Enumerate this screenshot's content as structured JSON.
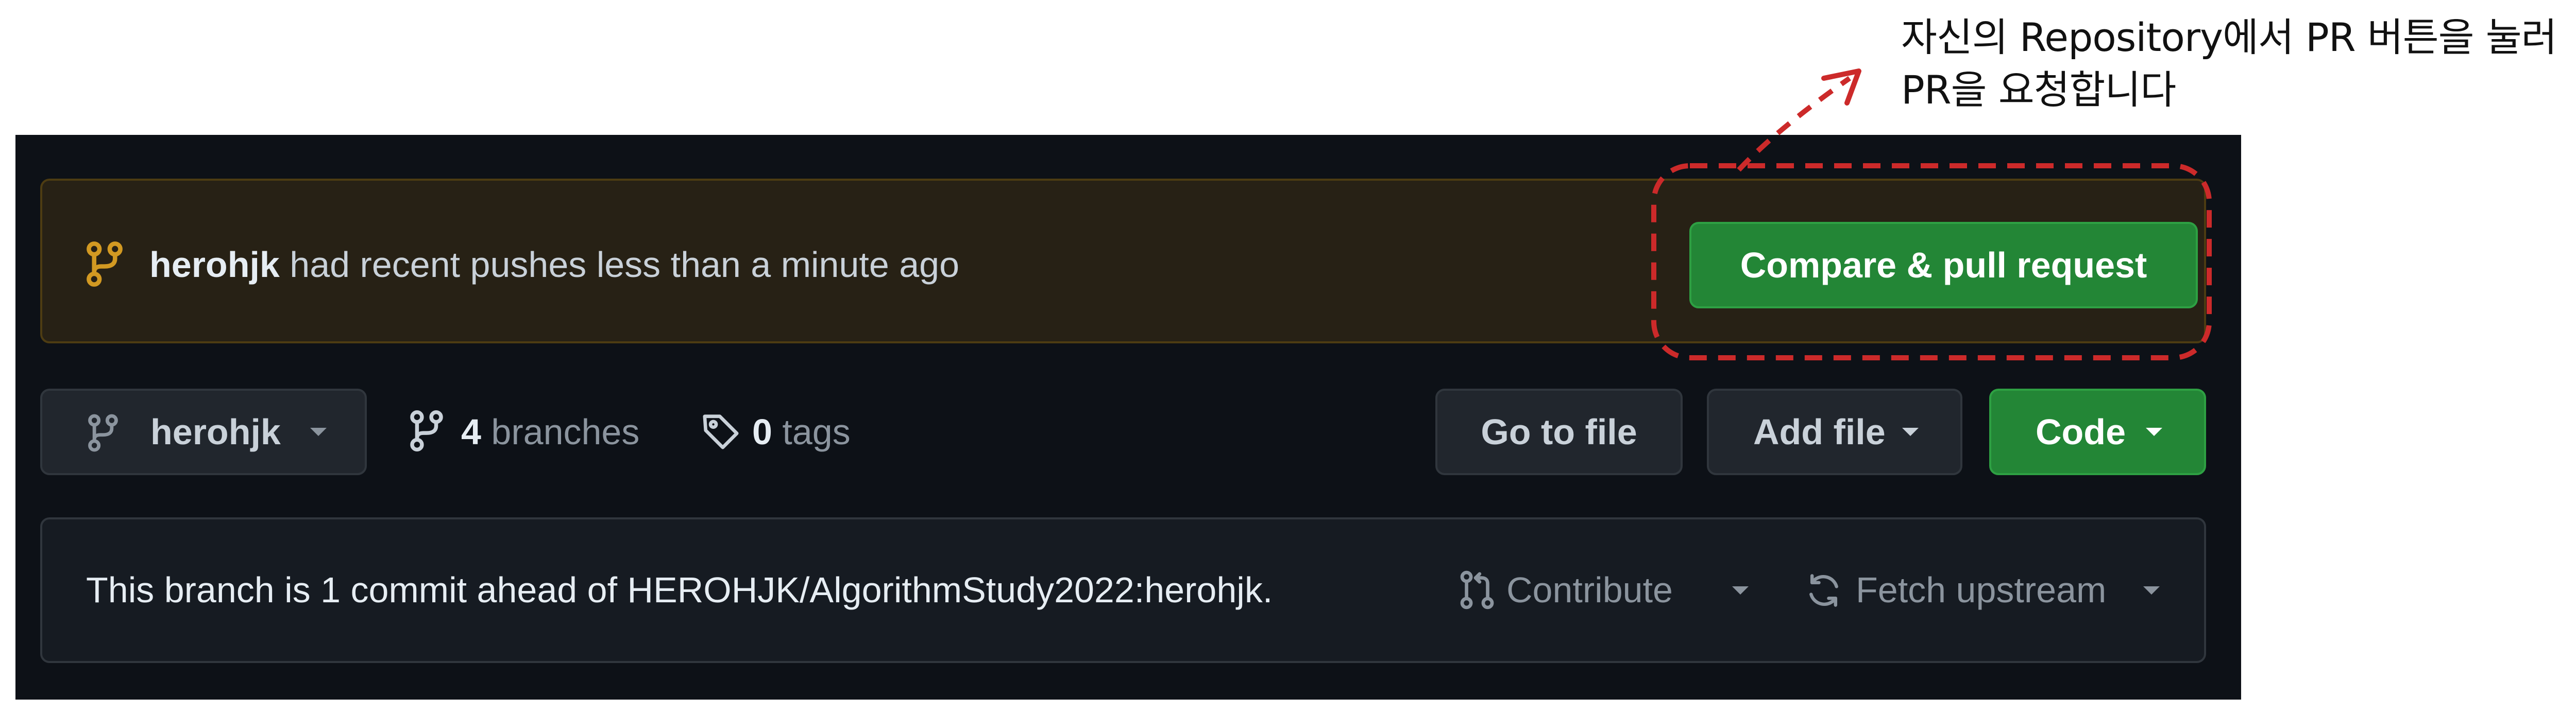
{
  "annotation": {
    "line1": "자신의 Repository에서 PR 버튼을 눌러",
    "line2": "PR을 요청합니다",
    "color": "#cc2a2a"
  },
  "banner": {
    "user": "herohjk",
    "message": "had recent pushes less than a minute ago",
    "button_label": "Compare & pull request",
    "icon": "git-branch-icon"
  },
  "toolbar": {
    "branch_name": "herohjk",
    "branches_count": "4",
    "branches_label": "branches",
    "tags_count": "0",
    "tags_label": "tags",
    "goto_label": "Go to file",
    "add_file_label": "Add file",
    "code_label": "Code"
  },
  "commit_status": {
    "text": "This branch is 1 commit ahead of HEROHJK/AlgorithmStudy2022:herohjk.",
    "contribute_label": "Contribute",
    "fetch_label": "Fetch upstream"
  },
  "colors": {
    "background": "#0d1117",
    "accent_green": "#238636",
    "banner_bg": "#272115",
    "banner_icon": "#d29922"
  }
}
